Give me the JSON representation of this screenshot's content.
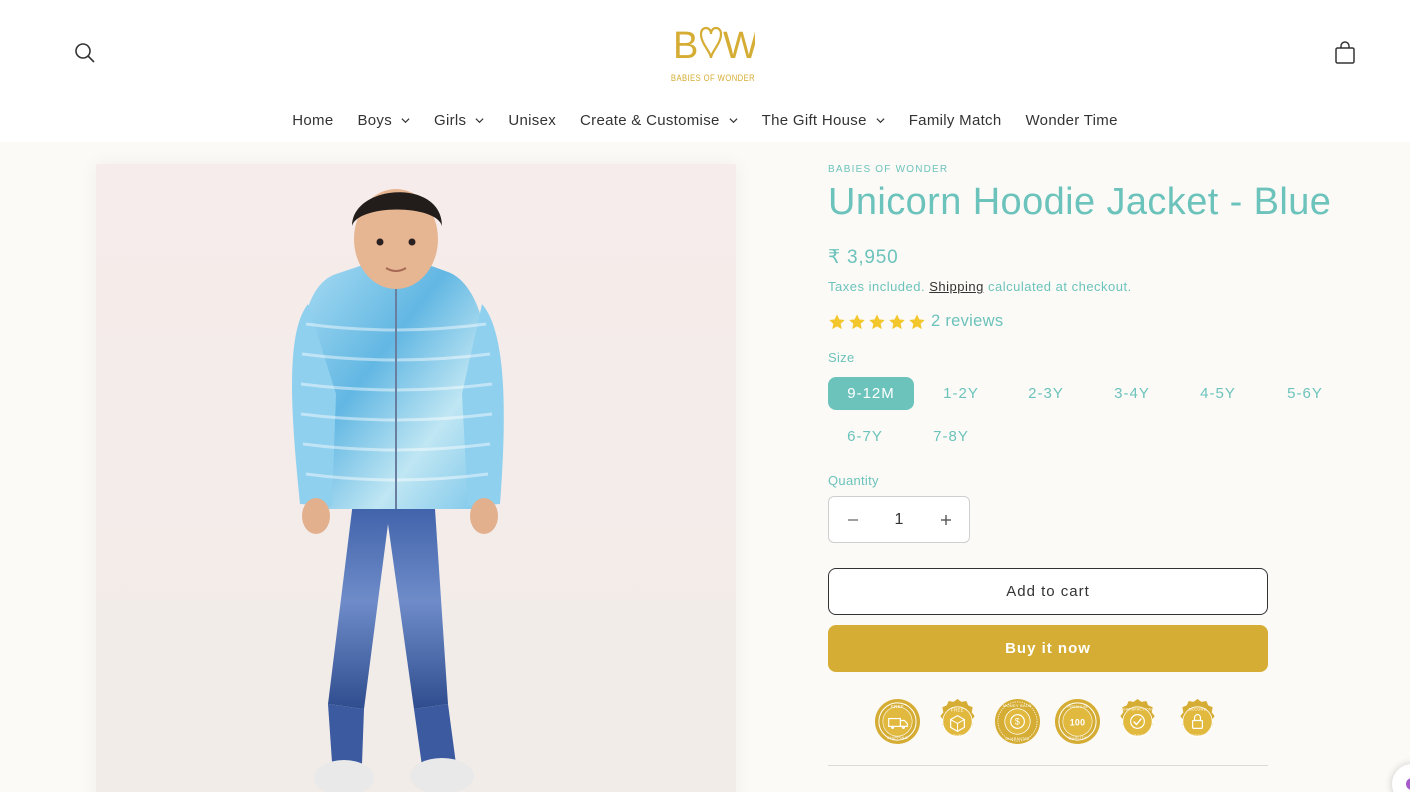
{
  "header": {
    "logo_mark": "BOW",
    "logo_subtitle": "BABIES OF WONDER",
    "icons": {
      "search": "search-icon",
      "cart": "cart-icon"
    }
  },
  "nav": [
    {
      "label": "Home",
      "dropdown": false
    },
    {
      "label": "Boys",
      "dropdown": true
    },
    {
      "label": "Girls",
      "dropdown": true
    },
    {
      "label": "Unisex",
      "dropdown": false
    },
    {
      "label": "Create & Customise",
      "dropdown": true
    },
    {
      "label": "The Gift House",
      "dropdown": true
    },
    {
      "label": "Family Match",
      "dropdown": false
    },
    {
      "label": "Wonder Time",
      "dropdown": false
    }
  ],
  "product": {
    "vendor": "BABIES OF WONDER",
    "title": "Unicorn Hoodie Jacket - Blue",
    "price": "₹ 3,950",
    "tax_prefix": "Taxes included.",
    "tax_link": "Shipping",
    "tax_suffix": "calculated at checkout.",
    "rating": {
      "stars": 5,
      "reviews_label": "2 reviews"
    },
    "size_label": "Size",
    "sizes": [
      "9-12M",
      "1-2Y",
      "2-3Y",
      "3-4Y",
      "4-5Y",
      "5-6Y",
      "6-7Y",
      "7-8Y"
    ],
    "selected_size": "9-12M",
    "quantity_label": "Quantity",
    "quantity": "1",
    "add_to_cart": "Add to cart",
    "buy_now": "Buy it now",
    "badges": [
      {
        "line1": "FREE",
        "line2": "SHIPPING"
      },
      {
        "line1": "FREE",
        "line2": "RETURNS"
      },
      {
        "line1": "MONEY BACK",
        "line2": "GUARANTEE"
      },
      {
        "line1": "PREMIUM",
        "line2": "QUALITY",
        "mid": "100"
      },
      {
        "line1": "SATISFACTION",
        "line2": "GUARANTEE"
      },
      {
        "line1": "SECURE",
        "line2": "CHECKOUT"
      }
    ]
  },
  "colors": {
    "accent": "#6cc3bc",
    "gold": "#d5ad34",
    "text": "#333333"
  }
}
